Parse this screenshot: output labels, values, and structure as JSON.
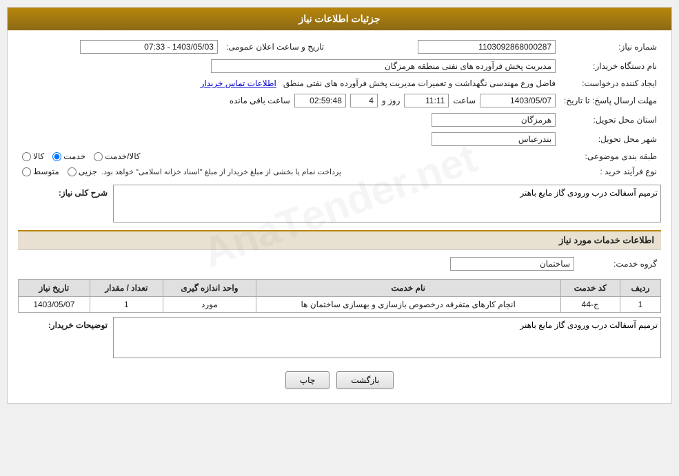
{
  "header": {
    "title": "جزئیات اطلاعات نیاز"
  },
  "fields": {
    "need_number_label": "شماره نیاز:",
    "need_number_value": "1103092868000287",
    "requester_label": "نام دستگاه خریدار:",
    "requester_value": "مدیریت پخش فرآورده های نفتی منطقه هرمزگان",
    "creator_label": "ایجاد کننده درخواست:",
    "creator_value": "فاضل ورع مهندسی نگهداشت و تعمیرات مدیریت پخش فرآورده های نفتی منطق",
    "creator_link": "اطلاعات تماس خریدار",
    "announce_label": "تاریخ و ساعت اعلان عمومی:",
    "announce_value": "1403/05/03 - 07:33",
    "response_deadline_label": "مهلت ارسال پاسخ: تا تاریخ:",
    "response_date": "1403/05/07",
    "response_time_label": "ساعت",
    "response_time": "11:11",
    "response_days_label": "روز و",
    "response_days": "4",
    "response_remaining_label": "ساعت باقی مانده",
    "response_remaining": "02:59:48",
    "province_label": "استان محل تحویل:",
    "province_value": "هرمزگان",
    "city_label": "شهر محل تحویل:",
    "city_value": "بندرعباس",
    "category_label": "طبقه بندی موضوعی:",
    "category_options": [
      "کالا",
      "خدمت",
      "کالا/خدمت"
    ],
    "category_selected": "خدمت",
    "process_label": "نوع فرآیند خرید :",
    "process_options": [
      "جزیی",
      "متوسط"
    ],
    "process_note": "پرداخت تمام یا بخشی از مبلغ خریدار از مبلغ \"اسناد خزانه اسلامی\" خواهد بود.",
    "need_summary_label": "شرح کلی نیاز:",
    "need_summary_value": "ترمیم آسفالت درب ورودی گاز مایع باهنر",
    "services_section_title": "اطلاعات خدمات مورد نیاز",
    "service_group_label": "گروه خدمت:",
    "service_group_value": "ساختمان",
    "table": {
      "headers": [
        "ردیف",
        "کد خدمت",
        "نام خدمت",
        "واحد اندازه گیری",
        "تعداد / مقدار",
        "تاریخ نیاز"
      ],
      "rows": [
        {
          "row": "1",
          "code": "ج-44",
          "name": "انجام کارهای متفرقه درخصوص بازسازی و بهسازی ساختمان ها",
          "unit": "مورد",
          "quantity": "1",
          "date": "1403/05/07"
        }
      ]
    },
    "buyer_desc_label": "توضیحات خریدار:",
    "buyer_desc_value": "ترمیم آسفالت درب ورودی گاز مایع باهنر",
    "buttons": {
      "print": "چاپ",
      "back": "بازگشت"
    }
  }
}
